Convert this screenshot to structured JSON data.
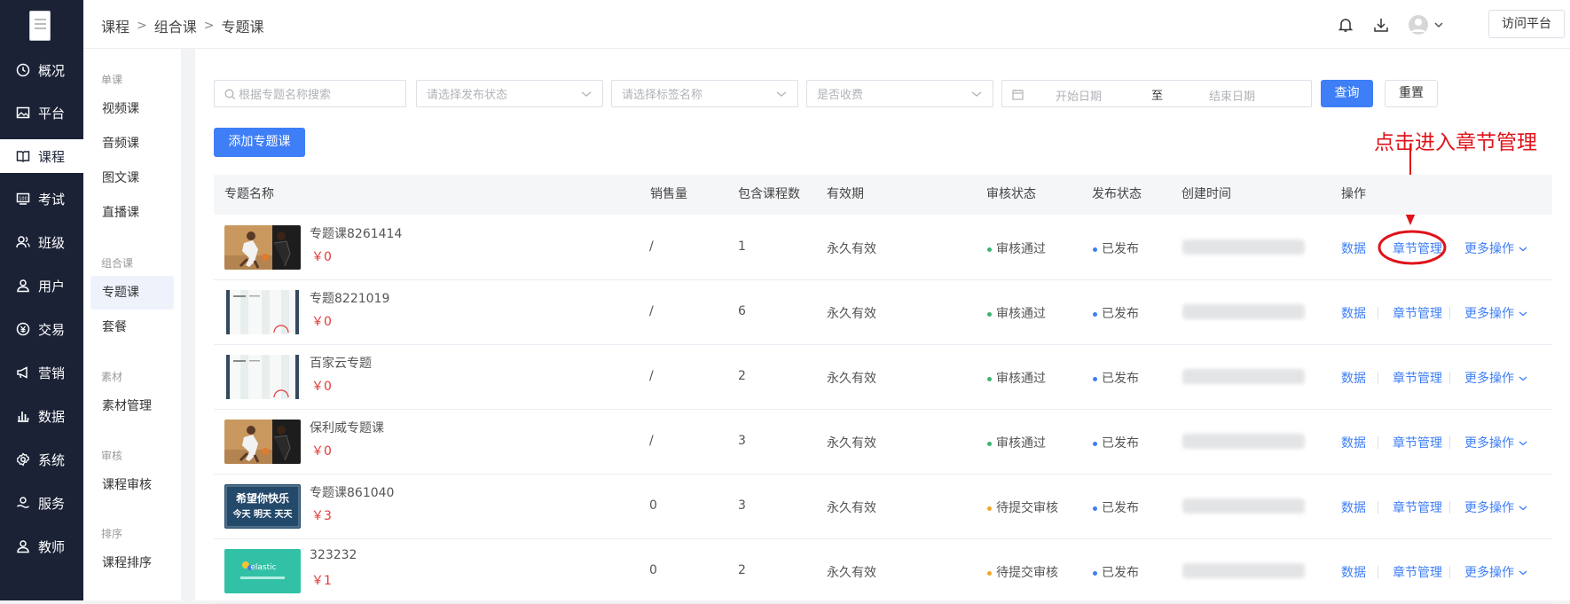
{
  "sidebar": {
    "items": [
      {
        "label": "概况",
        "icon": "clock-icon"
      },
      {
        "label": "平台",
        "icon": "image-icon"
      },
      {
        "label": "课程",
        "icon": "book-icon"
      },
      {
        "label": "考试",
        "icon": "score-icon"
      },
      {
        "label": "班级",
        "icon": "users-icon"
      },
      {
        "label": "用户",
        "icon": "user-icon"
      },
      {
        "label": "交易",
        "icon": "coin-icon"
      },
      {
        "label": "营销",
        "icon": "megaphone-icon"
      },
      {
        "label": "数据",
        "icon": "bar-chart-icon"
      },
      {
        "label": "系统",
        "icon": "gear-icon"
      },
      {
        "label": "服务",
        "icon": "service-icon"
      },
      {
        "label": "教师",
        "icon": "teacher-icon"
      }
    ]
  },
  "subnav": {
    "groups": [
      {
        "title": "单课",
        "items": [
          "视频课",
          "音频课",
          "图文课",
          "直播课"
        ]
      },
      {
        "title": "组合课",
        "items": [
          "专题课",
          "套餐"
        ]
      },
      {
        "title": "素材",
        "items": [
          "素材管理"
        ]
      },
      {
        "title": "审核",
        "items": [
          "课程审核"
        ]
      },
      {
        "title": "排序",
        "items": [
          "课程排序"
        ]
      }
    ]
  },
  "header": {
    "breadcrumb": [
      "课程",
      "组合课",
      "专题课"
    ],
    "visit_label": "访问平台"
  },
  "filters": {
    "search_placeholder": "根据专题名称搜索",
    "status_placeholder": "请选择发布状态",
    "tag_placeholder": "请选择标签名称",
    "charge_placeholder": "是否收费",
    "start_date": "开始日期",
    "date_sep": "至",
    "end_date": "结束日期",
    "query_label": "查询",
    "reset_label": "重置"
  },
  "add_label": "添加专题课",
  "annotation": "点击进入章节管理",
  "table": {
    "headers": [
      "专题名称",
      "销售量",
      "包含课程数",
      "有效期",
      "审核状态",
      "发布状态",
      "创建时间",
      "操作"
    ],
    "rows": [
      {
        "name": "专题课8261414",
        "price": "￥0",
        "sales": "/",
        "count": "1",
        "valid": "永久有效",
        "audit": "审核通过",
        "publish": "已发布",
        "thumb": "basketball"
      },
      {
        "name": "专题8221019",
        "price": "￥0",
        "sales": "/",
        "count": "6",
        "valid": "永久有效",
        "audit": "审核通过",
        "publish": "已发布",
        "thumb": "doc"
      },
      {
        "name": "百家云专题",
        "price": "￥0",
        "sales": "/",
        "count": "2",
        "valid": "永久有效",
        "audit": "审核通过",
        "publish": "已发布",
        "thumb": "doc"
      },
      {
        "name": "保利威专题课",
        "price": "￥0",
        "sales": "/",
        "count": "3",
        "valid": "永久有效",
        "audit": "审核通过",
        "publish": "已发布",
        "thumb": "basketball"
      },
      {
        "name": "专题课861040",
        "price": "￥3",
        "sales": "0",
        "count": "3",
        "valid": "永久有效",
        "audit": "待提交审核",
        "publish": "已发布",
        "thumb": "poster"
      },
      {
        "name": "323232",
        "price": "￥1",
        "sales": "0",
        "count": "2",
        "valid": "永久有效",
        "audit": "待提交审核",
        "publish": "已发布",
        "thumb": "elastic"
      }
    ],
    "ops": {
      "data": "数据",
      "chapter": "章节管理",
      "more": "更多操作"
    }
  },
  "thumb_texts": {
    "poster_line1": "希望你快乐",
    "poster_line2": "今天 明天 天天",
    "elastic": "elastic"
  },
  "colors": {
    "accent": "#3e7ef6",
    "sidebar": "#1b2236",
    "price": "#e23a3a",
    "annotation": "#e0131a",
    "approved": "#3cb371",
    "pending": "#f5a623"
  }
}
